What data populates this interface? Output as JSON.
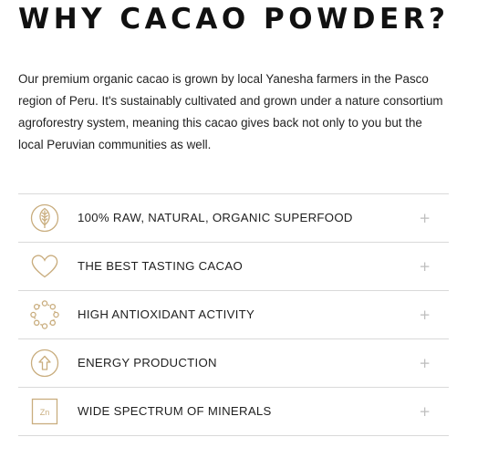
{
  "section": {
    "title": "WHY CACAO POWDER?",
    "intro": "Our premium organic cacao is grown by local Yanesha farmers in the Pasco region of Peru. It's sustainably cultivated and grown under a nature consortium agroforestry system, meaning this cacao gives back not only to you but the local Peruvian communities as well."
  },
  "colors": {
    "icon_gold": "#c9ad7e",
    "divider": "#d9d9d9",
    "plus": "#bdbdbd"
  },
  "benefits": [
    {
      "label": "100% RAW, NATURAL, ORGANIC SUPERFOOD",
      "icon": "leaf-icon",
      "toggle": "+"
    },
    {
      "label": "THE BEST TASTING CACAO",
      "icon": "heart-icon",
      "toggle": "+"
    },
    {
      "label": "HIGH ANTIOXIDANT ACTIVITY",
      "icon": "molecule-ring-icon",
      "toggle": "+"
    },
    {
      "label": "ENERGY PRODUCTION",
      "icon": "arrow-up-circle-icon",
      "toggle": "+"
    },
    {
      "label": "WIDE SPECTRUM OF MINERALS",
      "icon": "zinc-element-icon",
      "icon_text": "Zn",
      "toggle": "+"
    }
  ]
}
